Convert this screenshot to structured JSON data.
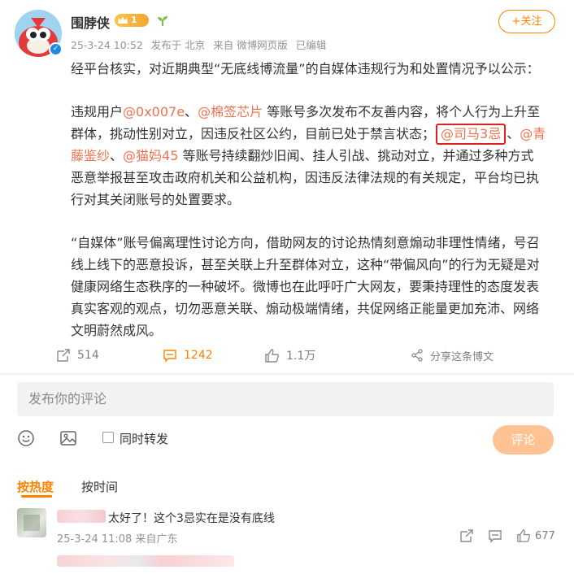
{
  "post": {
    "author": "围脖侠",
    "vip_level": "1",
    "meta": {
      "timestamp": "25-3-24 10:52",
      "location": "发布于 北京",
      "source": "来自 微博网页版",
      "edited": "已编辑"
    },
    "follow_label": "+关注",
    "paragraph1": "经平台核实，对近期典型“无底线博流量”的自媒体违规行为和处置情况予以公示：",
    "paragraph2": {
      "line1_prefix": "违规用户",
      "mention1": "@0x007e",
      "sep1": "、",
      "mention2": "@棉签芯片",
      "line1_suffix": " 等账号多次发布不友善内容，将个人行为上升至",
      "line2_prefix": "群体，挑动性别对立，因违反社区公约，目前已处于禁言状态；",
      "mention3": "@司马3忌",
      "sep2": "、",
      "mention4a": "@青",
      "mention4b": "藤鉴纱",
      "sep3": "、",
      "mention5": "@猫妈45",
      "line3_suffix": " 等账号持续翻炒旧闻、挂人引战、挑动对立，并通过多种方式",
      "line4": "恶意举报甚至攻击政府机关和公益机构，因违反法律法规的有关规定，平台均已执",
      "line5": "行对其关闭账号的处置要求。"
    },
    "paragraph3": [
      "“自媒体”账号偏离理性讨论方向，借助网友的讨论热情刻意煽动非理性情绪，号召",
      "线上线下的恶意投诉，甚至关联上升至群体对立，这种“带偏风向”的行为无疑是对",
      "健康网络生态秩序的一种破坏。微博也在此呼吁广大网友，要秉持理性的态度发表",
      "真实客观的观点，切勿恶意关联、煽动极端情绪，共促网络正能量更加充沛、网络",
      "文明蔚然成风。"
    ]
  },
  "actions": {
    "reposts": "514",
    "comments": "1242",
    "likes": "1.1万",
    "share": "分享这条博文"
  },
  "comment_box": {
    "placeholder": "发布你的评论",
    "repost_label": "同时转发",
    "submit_label": "评论"
  },
  "sort": {
    "hot": "按热度",
    "time": "按时间"
  },
  "comments": [
    {
      "text": "太好了！这个3忌实在是没有底线",
      "meta": "25-3-24 11:08 来自广东",
      "likes": "677"
    }
  ],
  "colors": {
    "accent": "#ff8200",
    "mention": "#eb7350",
    "highlight_box": "#e02020",
    "submit_disabled": "#ffc393"
  },
  "icons": {
    "repost": "repost-icon",
    "comment": "comment-icon",
    "like": "like-icon",
    "share": "share-icon",
    "emoji": "emoji-icon",
    "image": "image-icon"
  }
}
